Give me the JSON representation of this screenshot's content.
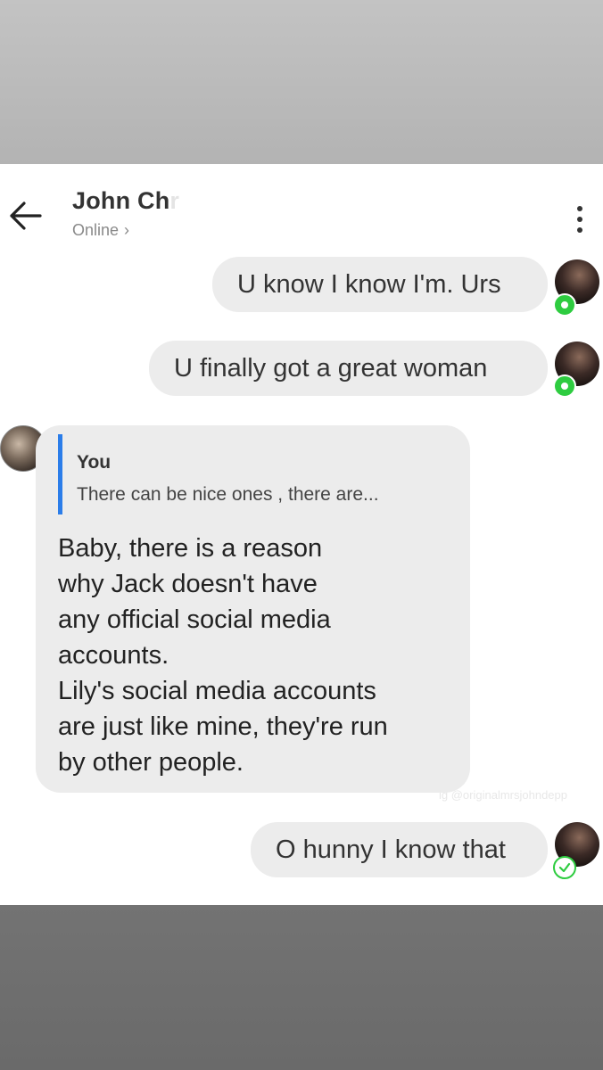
{
  "header": {
    "title": "John Chr",
    "status": "Online",
    "status_chevron": "›"
  },
  "messages": [
    {
      "side": "out",
      "text": "U know I know I'm. Urs",
      "receipt": "seen"
    },
    {
      "side": "out",
      "text": "U finally got a great woman",
      "receipt": "seen"
    },
    {
      "side": "in",
      "reply_to_name": "You",
      "reply_to_text": "There can be nice ones , there are...",
      "text": "Baby, there is a reason\nwhy Jack doesn't have\nany official social media\naccounts.\nLily's social media accounts\nare just like mine, they're run\nby other people."
    },
    {
      "side": "out",
      "text": "O hunny I know that",
      "receipt": "sent"
    }
  ],
  "watermark": "ig @originalmrsjohndepp",
  "colors": {
    "bubble": "#ececec",
    "quote_bar": "#2b7de9",
    "receipt_green": "#2ecc40"
  },
  "icons": {
    "back": "arrow-left",
    "more": "three-vertical-dots"
  }
}
